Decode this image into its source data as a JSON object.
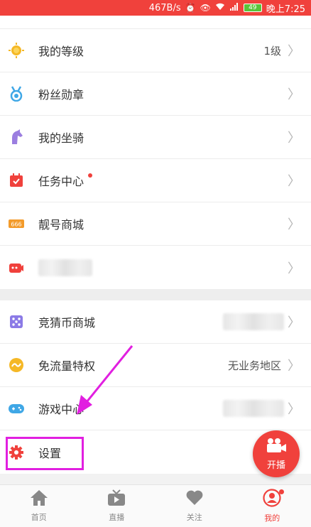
{
  "status_bar": {
    "speed": "467B/s",
    "signal": "⁴ᴳ",
    "battery": "49",
    "time": "晚上7:25"
  },
  "menu": {
    "group1": [
      {
        "label": "我的等级",
        "value": "1级",
        "icon": "level-icon"
      },
      {
        "label": "粉丝勋章",
        "value": "",
        "icon": "medal-icon"
      },
      {
        "label": "我的坐骑",
        "value": "",
        "icon": "horse-icon"
      },
      {
        "label": "任务中心",
        "value": "",
        "icon": "task-icon",
        "badge": true
      },
      {
        "label": "靓号商城",
        "value": "",
        "icon": "number-icon"
      },
      {
        "label": "",
        "value": "",
        "icon": "video-icon",
        "blurred": true
      }
    ],
    "group2": [
      {
        "label": "竞猜币商城",
        "value": "",
        "icon": "dice-icon",
        "blurred_value": true
      },
      {
        "label": "免流量特权",
        "value": "无业务地区",
        "icon": "data-free-icon"
      },
      {
        "label": "游戏中心",
        "value": "",
        "icon": "gamepad-icon",
        "blurred_value": true
      },
      {
        "label": "设置",
        "value": "",
        "icon": "settings-icon"
      }
    ]
  },
  "fab": {
    "label": "开播"
  },
  "tabs": [
    {
      "label": "首页",
      "icon": "home-icon"
    },
    {
      "label": "直播",
      "icon": "tv-icon"
    },
    {
      "label": "关注",
      "icon": "heart-icon"
    },
    {
      "label": "我的",
      "icon": "profile-icon",
      "active": true
    }
  ],
  "colors": {
    "accent": "#f0413c",
    "annotation": "#e11fe0"
  }
}
